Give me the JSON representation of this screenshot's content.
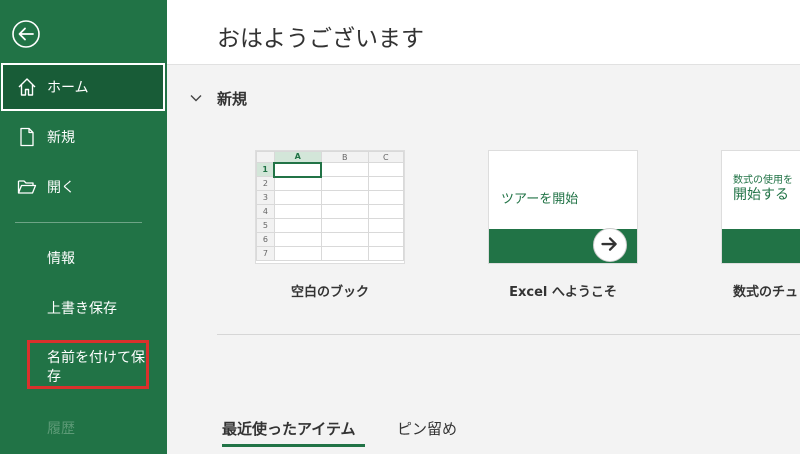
{
  "sidebar": {
    "items": [
      {
        "label": "ホーム"
      },
      {
        "label": "新規"
      },
      {
        "label": "開く"
      }
    ],
    "sub_items": [
      {
        "label": "情報"
      },
      {
        "label": "上書き保存"
      },
      {
        "label": "名前を付けて保存"
      },
      {
        "label": "履歴"
      }
    ]
  },
  "header": {
    "greeting": "おはようございます"
  },
  "section": {
    "title": "新規"
  },
  "grid": {
    "columns": [
      "A",
      "B",
      "C"
    ],
    "rows": [
      "1",
      "2",
      "3",
      "4",
      "5",
      "6",
      "7"
    ]
  },
  "templates": [
    {
      "caption": "空白のブック"
    },
    {
      "caption": "Excel へようこそ",
      "tile_text": "ツアーを開始"
    },
    {
      "caption": "数式のチュ",
      "tile_small": "数式の使用を",
      "tile_big": "開始する"
    }
  ],
  "tabs": [
    {
      "label": "最近使ったアイテム"
    },
    {
      "label": "ピン留め"
    }
  ],
  "colors": {
    "brand": "#217346",
    "highlight": "#d9312c"
  }
}
